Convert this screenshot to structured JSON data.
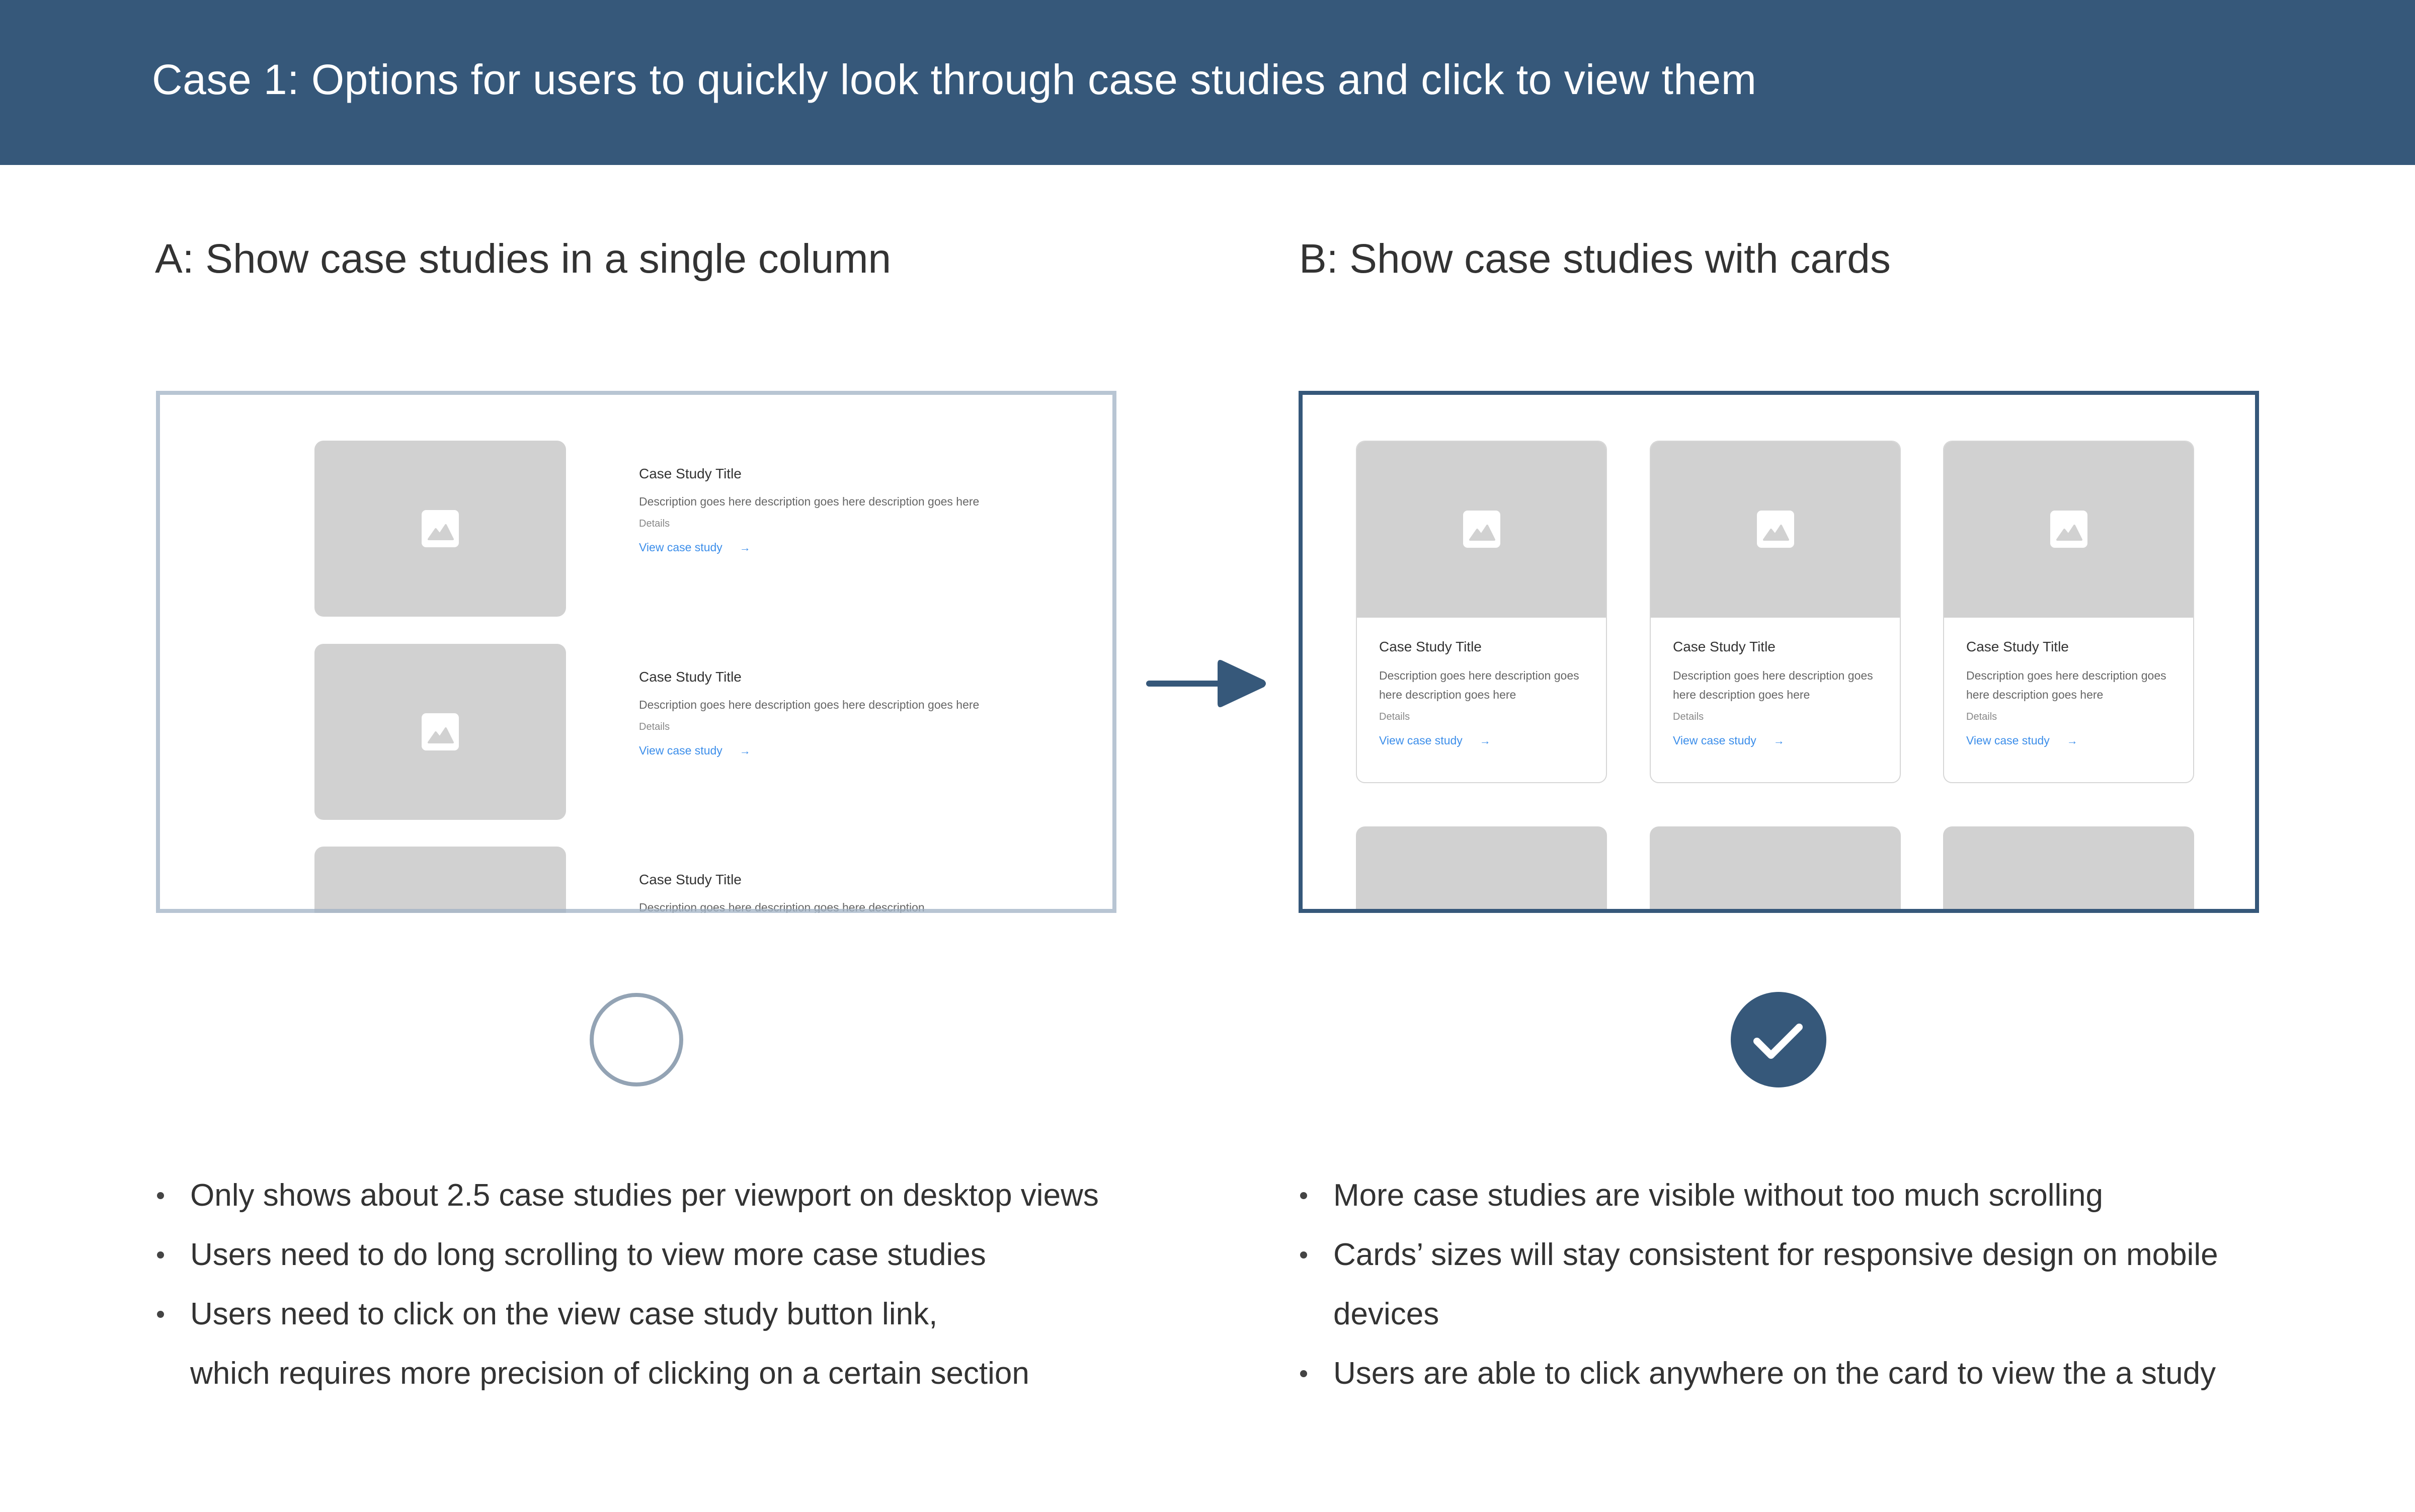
{
  "header": {
    "title": "Case 1: Options for users to quickly look through case studies and click to view them"
  },
  "colors": {
    "brand": "#36587A",
    "unselected_frame": "#B7C4D1",
    "unselected_circle": "#93A3B4",
    "placeholder": "#D1D1D1",
    "link": "#3C8EEA"
  },
  "option_a": {
    "heading": "A: Show case studies in a single column",
    "selected": false,
    "selection_icon": "empty-circle-icon",
    "items": [
      {
        "title": "Case Study Title",
        "description": "Description goes here description goes here description goes here",
        "details": "Details",
        "link": "View case study",
        "icon": "image-placeholder-icon"
      },
      {
        "title": "Case Study Title",
        "description": "Description goes here description goes here description goes here",
        "details": "Details",
        "link": "View case study",
        "icon": "image-placeholder-icon"
      },
      {
        "title": "Case Study Title",
        "description": "Description goes here description goes here description",
        "details": "",
        "link": "",
        "icon": "image-placeholder-icon"
      }
    ],
    "notes": [
      "Only shows about 2.5 case studies per viewport on desktop views",
      "Users need to do long scrolling to view more case studies",
      "Users need to click on the view case study button link,",
      "which requires more precision of clicking on a certain section"
    ]
  },
  "transition": {
    "icon": "right-arrow-icon"
  },
  "option_b": {
    "heading": "B: Show case studies with cards",
    "selected": true,
    "selection_icon": "check-circle-icon",
    "cards": [
      {
        "title": "Case Study Title",
        "description": "Description goes here description goes here description goes here",
        "details": "Details",
        "link": "View case study",
        "icon": "image-placeholder-icon"
      },
      {
        "title": "Case Study Title",
        "description": "Description goes here description goes here description goes here",
        "details": "Details",
        "link": "View case study",
        "icon": "image-placeholder-icon"
      },
      {
        "title": "Case Study Title",
        "description": "Description goes here description goes here description goes here",
        "details": "Details",
        "link": "View case study",
        "icon": "image-placeholder-icon"
      }
    ],
    "notes": [
      "More case studies are visible without too much scrolling",
      "Cards’ sizes will stay consistent for responsive design on mobile",
      "devices",
      "Users are able to click anywhere on the card to view the a study"
    ],
    "link_arrow": "→"
  }
}
